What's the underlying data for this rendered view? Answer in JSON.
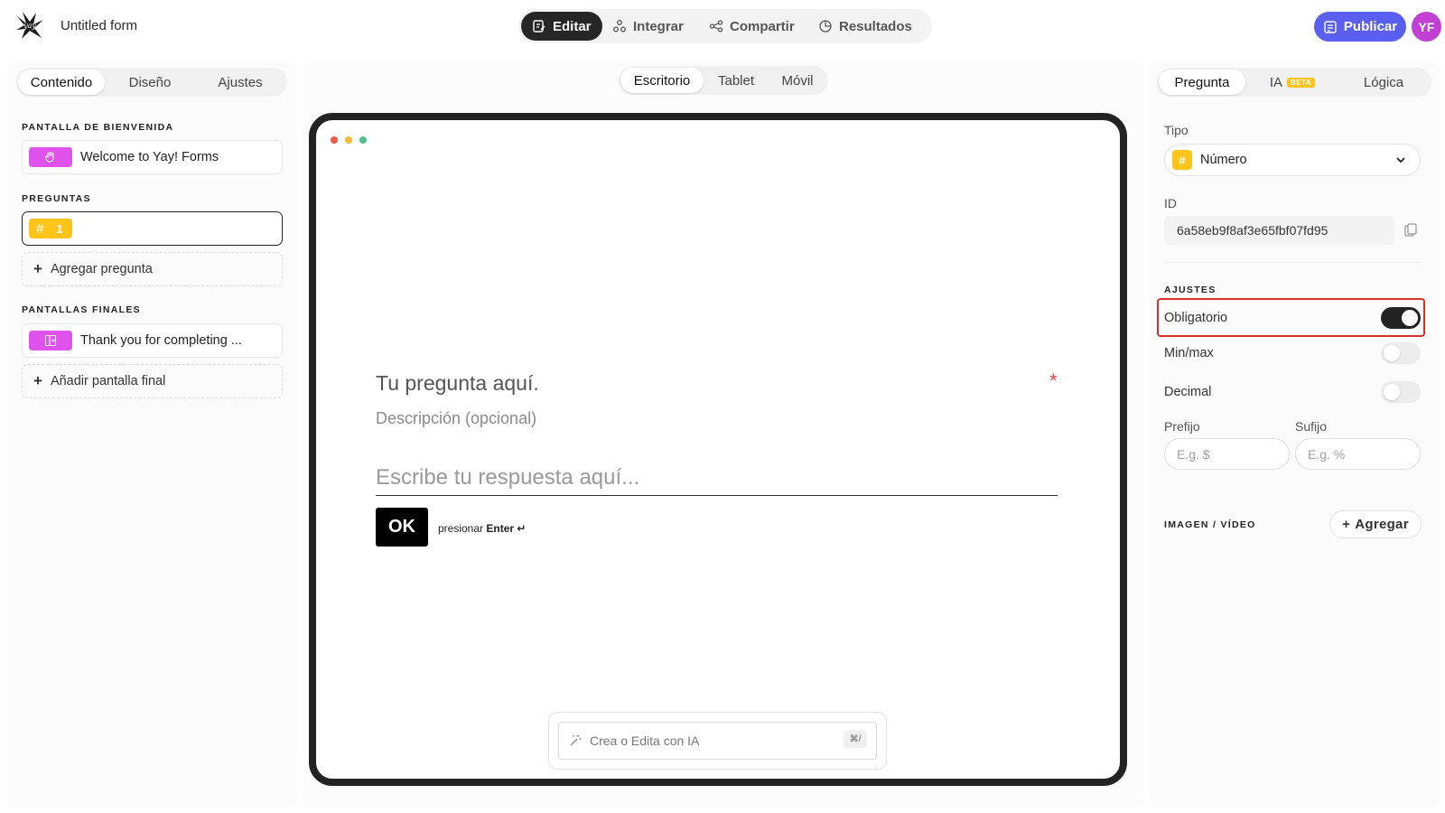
{
  "app": {
    "form_title": "Untitled form"
  },
  "mode_tabs": [
    {
      "label": "Editar",
      "icon": "edit-icon",
      "active": true
    },
    {
      "label": "Integrar",
      "icon": "integrate-icon",
      "active": false
    },
    {
      "label": "Compartir",
      "icon": "share-icon",
      "active": false
    },
    {
      "label": "Resultados",
      "icon": "results-icon",
      "active": false
    }
  ],
  "header": {
    "publish_label": "Publicar",
    "avatar_initials": "YF"
  },
  "left_panel": {
    "tabs": [
      "Contenido",
      "Diseño",
      "Ajustes"
    ],
    "active_tab": "Contenido",
    "welcome_section": "PANTALLA DE BIENVENIDA",
    "welcome_item": "Welcome to Yay! Forms",
    "questions_section": "PREGUNTAS",
    "question_items": [
      {
        "number": "1",
        "label": ""
      }
    ],
    "add_question": "Agregar pregunta",
    "endings_section": "PANTALLAS FINALES",
    "ending_item": "Thank you for completing ...",
    "add_ending": "Añadir pantalla final"
  },
  "center": {
    "device_tabs": [
      "Escritorio",
      "Tablet",
      "Móvil"
    ],
    "active_device": "Escritorio",
    "question_title": "Tu pregunta aquí.",
    "required_mark": "*",
    "description": "Descripción (opcional)",
    "answer_placeholder": "Escribe tu respuesta aquí...",
    "ok_label": "OK",
    "enter_hint_prefix": "presionar",
    "enter_hint_key": "Enter ↵",
    "ai_placeholder": "Crea o Edita con IA",
    "ai_shortcut": "⌘/"
  },
  "right_panel": {
    "tabs": [
      "Pregunta",
      "IA",
      "Lógica"
    ],
    "ia_badge": "BETA",
    "active_tab": "Pregunta",
    "type_label": "Tipo",
    "type_value": "Número",
    "id_label": "ID",
    "id_value": "6a58eb9f8af3e65fbf07fd95",
    "settings_section": "AJUSTES",
    "toggles": [
      {
        "label": "Obligatorio",
        "on": true
      },
      {
        "label": "Min/max",
        "on": false
      },
      {
        "label": "Decimal",
        "on": false
      }
    ],
    "prefix_label": "Prefijo",
    "prefix_placeholder": "E.g. $",
    "suffix_label": "Sufijo",
    "suffix_placeholder": "E.g. %",
    "media_section": "IMAGEN / VÍDEO",
    "add_media": "Agregar"
  },
  "colors": {
    "accent": "#5b5ff0",
    "avatar": "#c23fd3",
    "question_chip": "#ffc41a",
    "screen_chip": "#e052ec",
    "highlight": "#d9312a"
  }
}
